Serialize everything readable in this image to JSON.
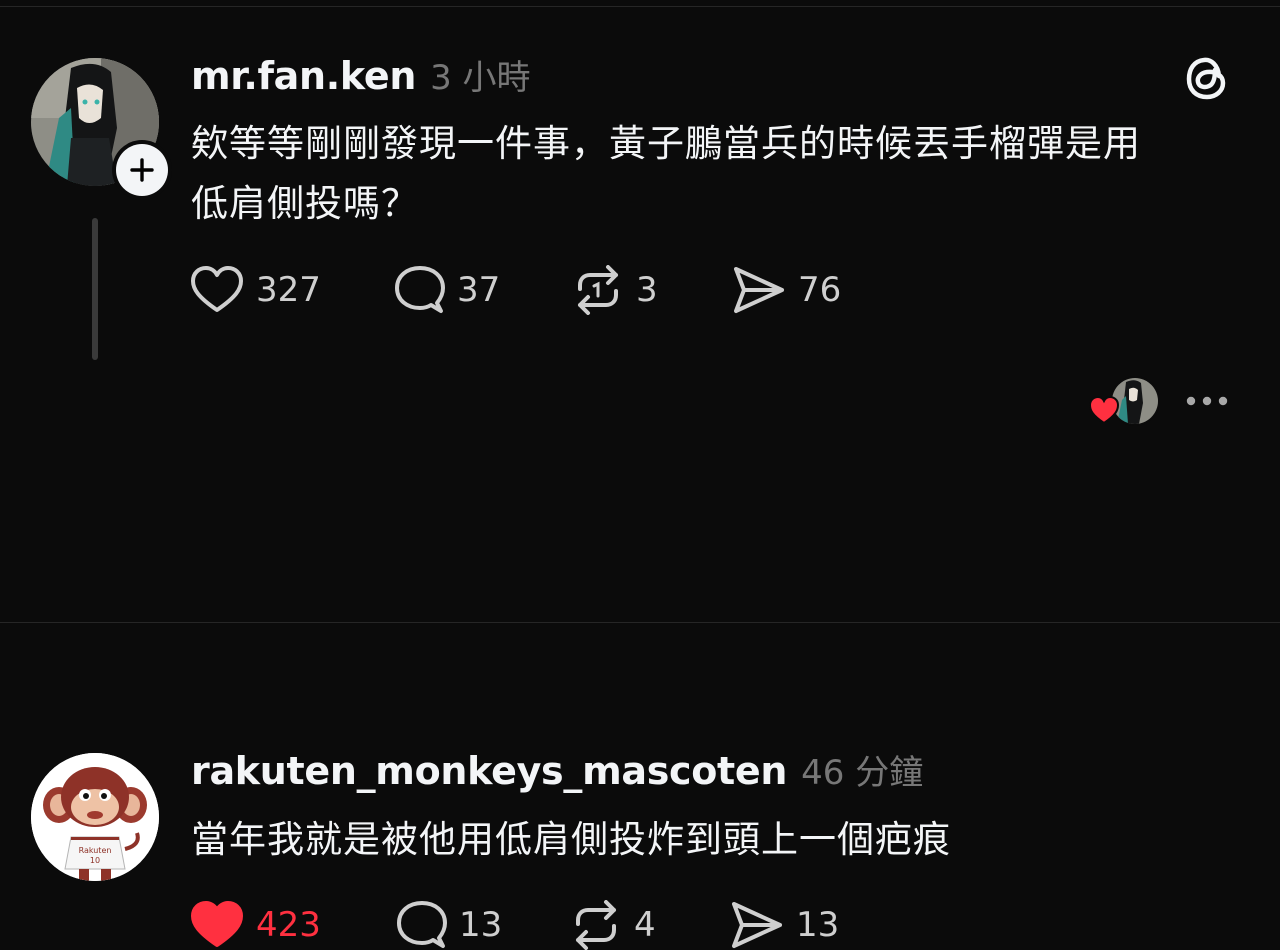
{
  "posts": [
    {
      "username": "mr.fan.ken",
      "timestamp": "3 小時",
      "body_lines": [
        "欸等等剛剛發現一件事，黃子鵬當兵的時候丟手榴彈是用",
        "低肩側投嗎？"
      ],
      "likes": "327",
      "replies": "37",
      "reposts": "3",
      "shares": "76",
      "liked": false
    },
    {
      "username": "rakuten_monkeys_mascoten",
      "timestamp": "46 分鐘",
      "body_lines": [
        "當年我就是被他用低肩側投炸到頭上一個疤痕"
      ],
      "likes": "423",
      "replies": "13",
      "reposts": "4",
      "shares": "13",
      "liked": true,
      "mascot_jersey_text": "Rakuten",
      "mascot_jersey_number": "10"
    }
  ],
  "colors": {
    "background": "#0b0b0b",
    "text": "#f3f5f7",
    "muted": "#777777",
    "like_red": "#ff3040"
  },
  "icons": {
    "app_logo": "threads-logo-icon",
    "follow": "plus-icon",
    "like": "heart-icon",
    "reply": "comment-icon",
    "repost": "repost-icon",
    "share": "send-icon",
    "more": "more-dots-icon"
  }
}
